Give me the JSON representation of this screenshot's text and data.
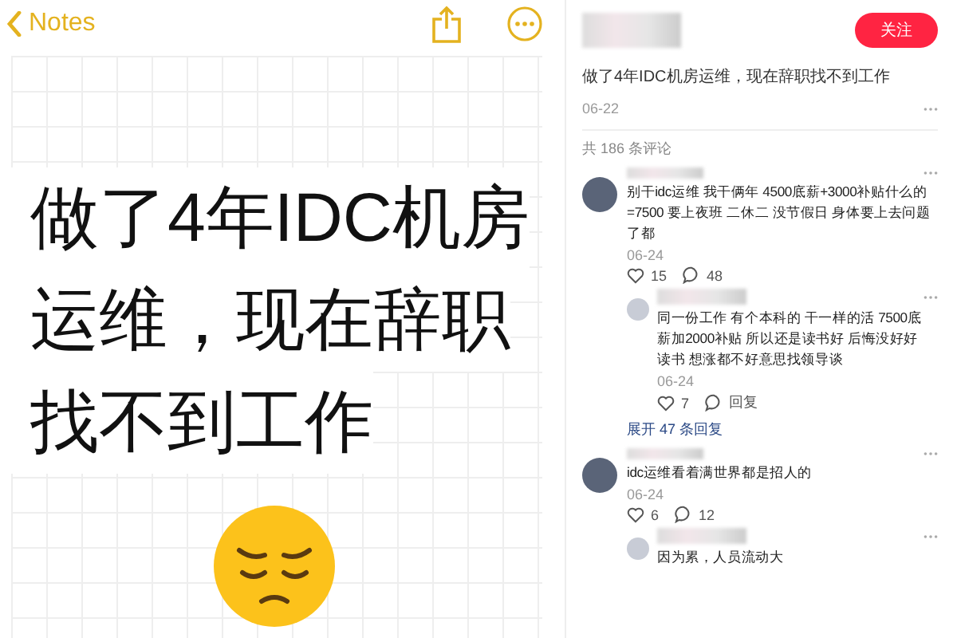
{
  "notes_screenshot": {
    "back_label": "Notes",
    "body_lines": [
      "做了4年IDC机房",
      "运维，现在辞职",
      "找不到工作"
    ]
  },
  "post": {
    "follow_label": "关注",
    "title": "做了4年IDC机房运维，现在辞职找不到工作",
    "date": "06-22",
    "comment_count": "共 186 条评论",
    "comments": [
      {
        "text": "别干idc运维 我干俩年 4500底薪+3000补贴什么的=7500 要上夜班 二休二 没节假日 身体要上去问题了都",
        "date": "06-24",
        "likes": "15",
        "reply_count": "48",
        "replies": [
          {
            "text": "同一份工作 有个本科的 干一样的活 7500底薪加2000补贴 所以还是读书好 后悔没好好读书 想涨都不好意思找领导谈",
            "date": "06-24",
            "likes": "7",
            "reply_label": "回复"
          }
        ],
        "expand_label": "展开 47 条回复"
      },
      {
        "text": "idc运维看着满世界都是招人的",
        "date": "06-24",
        "likes": "6",
        "reply_count": "12",
        "replies": [
          {
            "text": "因为累，人员流动大"
          }
        ]
      }
    ]
  }
}
